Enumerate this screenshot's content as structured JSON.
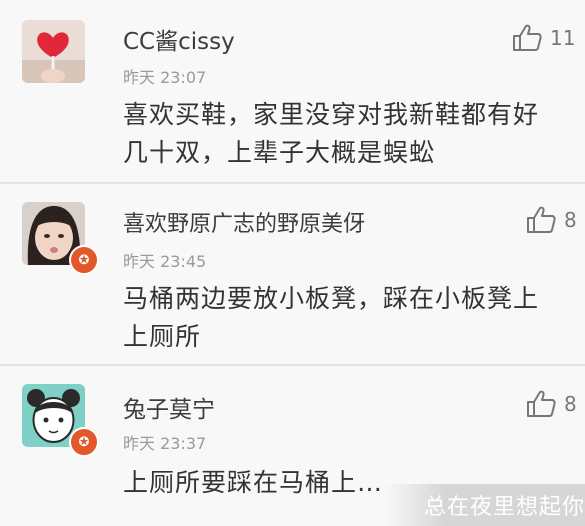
{
  "comments": [
    {
      "user": "CC酱cissy",
      "time": "昨天 23:07",
      "text": "喜欢买鞋，家里没穿对我新鞋都有好几十双，上辈子大概是蜈蚣",
      "likes": "11",
      "avatar_icon": "heart-lollipop-avatar"
    },
    {
      "user": "喜欢野原广志的野原美伢",
      "time": "昨天 23:45",
      "text": "马桶两边要放小板凳，踩在小板凳上上厕所",
      "likes": "8",
      "avatar_icon": "girl-photo-avatar",
      "badge_icon": "star-badge-icon"
    },
    {
      "user": "兔子莫宁",
      "time": "昨天 23:37",
      "text": "上厕所要踩在马桶上…",
      "likes": "8",
      "avatar_icon": "cartoon-girl-avatar",
      "badge_icon": "star-badge-icon"
    }
  ],
  "watermark": "总在夜里想起你",
  "colors": {
    "badge": "#e2582b",
    "background": "#f7f7f7",
    "divider": "#e3e3e3"
  }
}
